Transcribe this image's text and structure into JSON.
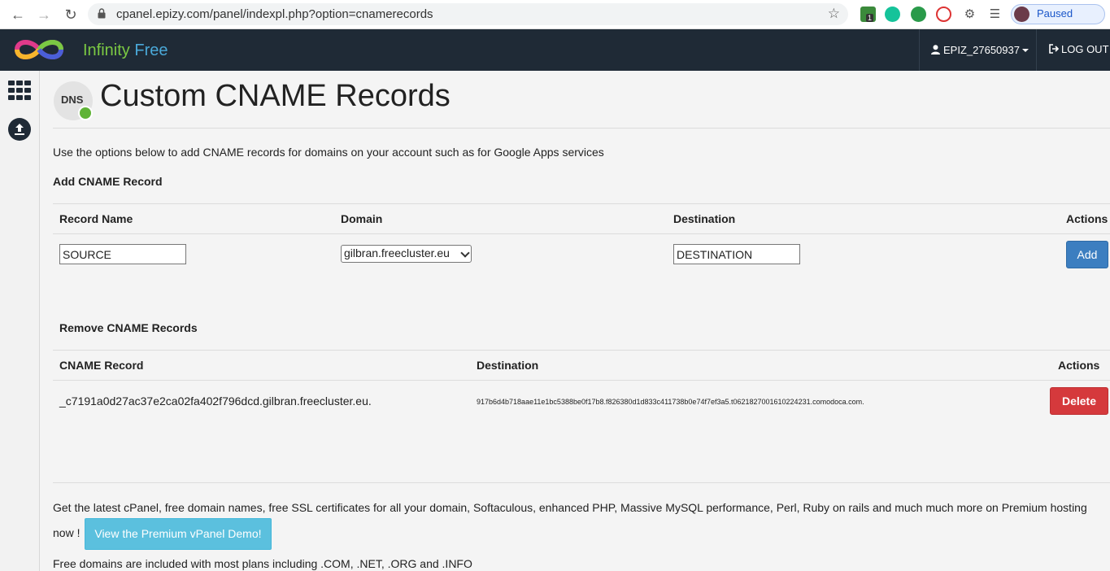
{
  "browser": {
    "url": "cpanel.epizy.com/panel/indexpl.php?option=cnamerecords",
    "paused_label": "Paused",
    "ext_badge": "1"
  },
  "header": {
    "logo_word1": "Infinity",
    "logo_word2": "Free",
    "username": "EPIZ_27650937",
    "logout_label": "LOG OUT"
  },
  "page": {
    "badge_text": "DNS",
    "title": "Custom CNAME Records",
    "intro": "Use the options below to add CNAME records for domains on your account such as for Google Apps services"
  },
  "add_section": {
    "title": "Add CNAME Record",
    "columns": [
      "Record Name",
      "Domain",
      "Destination",
      "Actions"
    ],
    "record_name_value": "SOURCE",
    "domain_selected": "gilbran.freecluster.eu",
    "destination_value": "DESTINATION",
    "add_label": "Add"
  },
  "remove_section": {
    "title": "Remove CNAME Records",
    "columns": [
      "CNAME Record",
      "Destination",
      "Actions"
    ],
    "rows": [
      {
        "record": "_c7191a0d27ac37e2ca02fa402f796dcd.gilbran.freecluster.eu.",
        "destination": "917b6d4b718aae11e1bc5388be0f17b8.f826380d1d833c411738b0e74f7ef3a5.t0621827001610224231.comodoca.com.",
        "delete_label": "Delete"
      }
    ]
  },
  "footer": {
    "promo": "Get the latest cPanel, free domain names, free SSL certificates for all your domain, Softaculous, enhanced PHP, Massive MySQL performance, Perl, Ruby on rails and much much more on Premium hosting now !",
    "demo_button": "View the Premium vPanel Demo!",
    "free_domains": "Free domains are included with most plans including .COM, .NET, .ORG and .INFO"
  },
  "colors": {
    "header_bg": "#1f2a36",
    "add_button": "#3c7ec0",
    "delete_button": "#d5393c",
    "demo_button": "#5bc0de",
    "logo_green": "#7bc943",
    "logo_blue": "#4aa8d8"
  }
}
